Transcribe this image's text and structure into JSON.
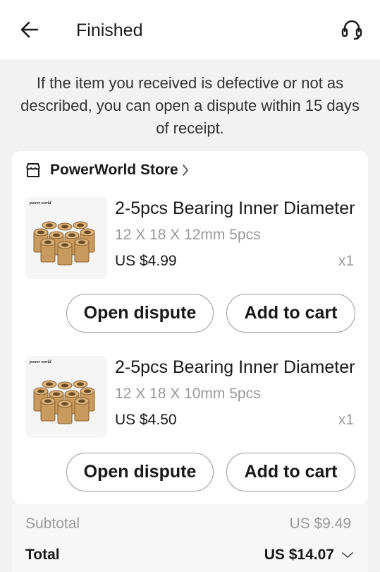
{
  "header": {
    "title": "Finished",
    "back_icon": "arrow-left-icon",
    "support_icon": "headset-icon"
  },
  "notice": {
    "text": "If the item you received is defective or not as described, you can open a dispute within 15 days of receipt."
  },
  "store": {
    "name": "PowerWorld Store",
    "icon": "store-icon"
  },
  "items": [
    {
      "thumb_brand": "power world",
      "title": "2-5pcs Bearing Inner Diameter",
      "variant": "12 X 18 X 12mm 5pcs",
      "price": "US $4.99",
      "quantity": "x1",
      "dispute_label": "Open dispute",
      "cart_label": "Add to cart"
    },
    {
      "thumb_brand": "power world",
      "title": "2-5pcs Bearing Inner Diameter",
      "variant": "12 X 18 X 10mm 5pcs",
      "price": "US $4.50",
      "quantity": "x1",
      "dispute_label": "Open dispute",
      "cart_label": "Add to cart"
    }
  ],
  "summary": {
    "subtotal_label": "Subtotal",
    "subtotal_value": "US $9.49",
    "total_label": "Total",
    "total_value": "US $14.07"
  },
  "colors": {
    "background": "#f2f2f2",
    "card": "#ffffff",
    "muted_text": "#999999",
    "bronze": "#c89a5e"
  }
}
